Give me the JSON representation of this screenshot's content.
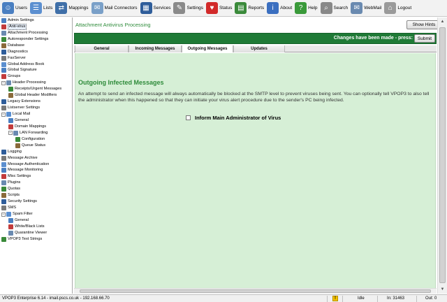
{
  "toolbar": {
    "items": [
      {
        "label": "Users",
        "icon": "users-icon",
        "color": "#4a7fc1"
      },
      {
        "label": "Lists",
        "icon": "lists-icon",
        "color": "#5b8fd0"
      },
      {
        "label": "Mappings",
        "icon": "mappings-icon",
        "color": "#3f6fa8"
      },
      {
        "label": "Mail Connectors",
        "icon": "mail-connectors-icon",
        "color": "#7aa0c8"
      },
      {
        "label": "Services",
        "icon": "services-icon",
        "color": "#2f5d9a"
      },
      {
        "label": "Settings",
        "icon": "settings-icon",
        "color": "#8a8a8a"
      },
      {
        "label": "Status",
        "icon": "status-heart-icon",
        "color": "#d22a2a"
      },
      {
        "label": "Reports",
        "icon": "reports-icon",
        "color": "#3a8a3a"
      },
      {
        "label": "About",
        "icon": "about-icon",
        "color": "#3b6fc0"
      },
      {
        "label": "Help",
        "icon": "help-icon",
        "color": "#3a9a3a"
      },
      {
        "label": "Search",
        "icon": "search-icon",
        "color": "#888888"
      },
      {
        "label": "WebMail",
        "icon": "webmail-icon",
        "color": "#6a8ab0"
      },
      {
        "label": "Logout",
        "icon": "logout-padlock-icon",
        "color": "#9a9a9a"
      }
    ]
  },
  "sidebar": {
    "items": [
      {
        "label": "Admin Settings",
        "indent": 0,
        "icon": "admin-settings-icon"
      },
      {
        "label": "Anti-virus",
        "indent": 0,
        "icon": "anti-virus-icon",
        "selected": true
      },
      {
        "label": "Attachment Processing",
        "indent": 0,
        "icon": "attachment-icon"
      },
      {
        "label": "Autoresponder Settings",
        "indent": 0,
        "icon": "autoresponder-icon"
      },
      {
        "label": "Database",
        "indent": 0,
        "icon": "database-icon"
      },
      {
        "label": "Diagnostics",
        "indent": 0,
        "icon": "diagnostics-icon"
      },
      {
        "label": "FaxServer",
        "indent": 0,
        "icon": "fax-icon"
      },
      {
        "label": "Global Address Book",
        "indent": 0,
        "icon": "address-book-icon"
      },
      {
        "label": "Global Signature",
        "indent": 0,
        "icon": "signature-icon"
      },
      {
        "label": "Groups",
        "indent": 0,
        "icon": "groups-icon"
      },
      {
        "label": "Header Processing",
        "indent": 0,
        "icon": "header-processing-icon",
        "expander": "-"
      },
      {
        "label": "Receipts/Urgent Messages",
        "indent": 1,
        "icon": "receipts-icon"
      },
      {
        "label": "Global Header Modifiers",
        "indent": 1,
        "icon": "header-modifiers-icon"
      },
      {
        "label": "Legacy Extensions",
        "indent": 0,
        "icon": "legacy-extensions-icon"
      },
      {
        "label": "Listserver Settings",
        "indent": 0,
        "icon": "listserver-icon"
      },
      {
        "label": "Local Mail",
        "indent": 0,
        "icon": "local-mail-icon",
        "expander": "-"
      },
      {
        "label": "General",
        "indent": 1,
        "icon": "general-icon"
      },
      {
        "label": "Domain Mappings",
        "indent": 1,
        "icon": "domain-mappings-icon"
      },
      {
        "label": "LAN Forwarding",
        "indent": 1,
        "icon": "lan-forwarding-icon",
        "expander": "-"
      },
      {
        "label": "Configuration",
        "indent": 2,
        "icon": "configuration-icon"
      },
      {
        "label": "Queue Status",
        "indent": 2,
        "icon": "queue-status-icon"
      },
      {
        "label": "Logging",
        "indent": 0,
        "icon": "logging-icon"
      },
      {
        "label": "Message Archive",
        "indent": 0,
        "icon": "message-archive-icon"
      },
      {
        "label": "Message Authentication",
        "indent": 0,
        "icon": "message-auth-icon"
      },
      {
        "label": "Message Monitoring",
        "indent": 0,
        "icon": "message-monitoring-icon"
      },
      {
        "label": "Misc Settings",
        "indent": 0,
        "icon": "misc-settings-icon"
      },
      {
        "label": "Plugins",
        "indent": 0,
        "icon": "plugins-icon"
      },
      {
        "label": "Quotas",
        "indent": 0,
        "icon": "quotas-icon"
      },
      {
        "label": "Scripts",
        "indent": 0,
        "icon": "scripts-icon"
      },
      {
        "label": "Security Settings",
        "indent": 0,
        "icon": "security-icon"
      },
      {
        "label": "SMS",
        "indent": 0,
        "icon": "sms-icon"
      },
      {
        "label": "Spam Filter",
        "indent": 0,
        "icon": "spam-filter-icon",
        "expander": "-"
      },
      {
        "label": "General",
        "indent": 1,
        "icon": "general-icon"
      },
      {
        "label": "White/Black Lists",
        "indent": 1,
        "icon": "white-black-lists-icon"
      },
      {
        "label": "Quarantine Viewer",
        "indent": 1,
        "icon": "quarantine-icon"
      },
      {
        "label": "VPOP3 Text Strings",
        "indent": 0,
        "icon": "text-strings-icon"
      }
    ]
  },
  "main": {
    "title": "Attachment Antivirus Processing",
    "show_hints_label": "Show Hints",
    "changes_text": "Changes have been made - press:",
    "submit_label": "Submit",
    "tabs": [
      {
        "label": "General",
        "active": false
      },
      {
        "label": "Incoming Messages",
        "active": false
      },
      {
        "label": "Outgoing Messages",
        "active": true
      },
      {
        "label": "Updates",
        "active": false
      }
    ],
    "section_heading": "Outgoing Infected Messages",
    "description": "An attempt to send an infected message will always automatically be blocked at the SMTP level to prevent viruses being sent. You can optionally tell VPOP3 to also tell the administrator when this happened so that they can initiate your virus alert procedure due to the sender's PC being infected.",
    "checkbox_label": "Inform Main Administrator of Virus",
    "checkbox_checked": false
  },
  "statusbar": {
    "app_info": "VPOP3 Enterprise 6.14 - imail.pscs.co.uk - 192.168.66.70",
    "state": "Idle",
    "in_count": "In: 31463",
    "out_count": "Out: 0"
  },
  "colors": {
    "accent_green": "#2e8b3a",
    "changes_bar": "#1f7a36",
    "content_bg": "#d6efd6"
  }
}
